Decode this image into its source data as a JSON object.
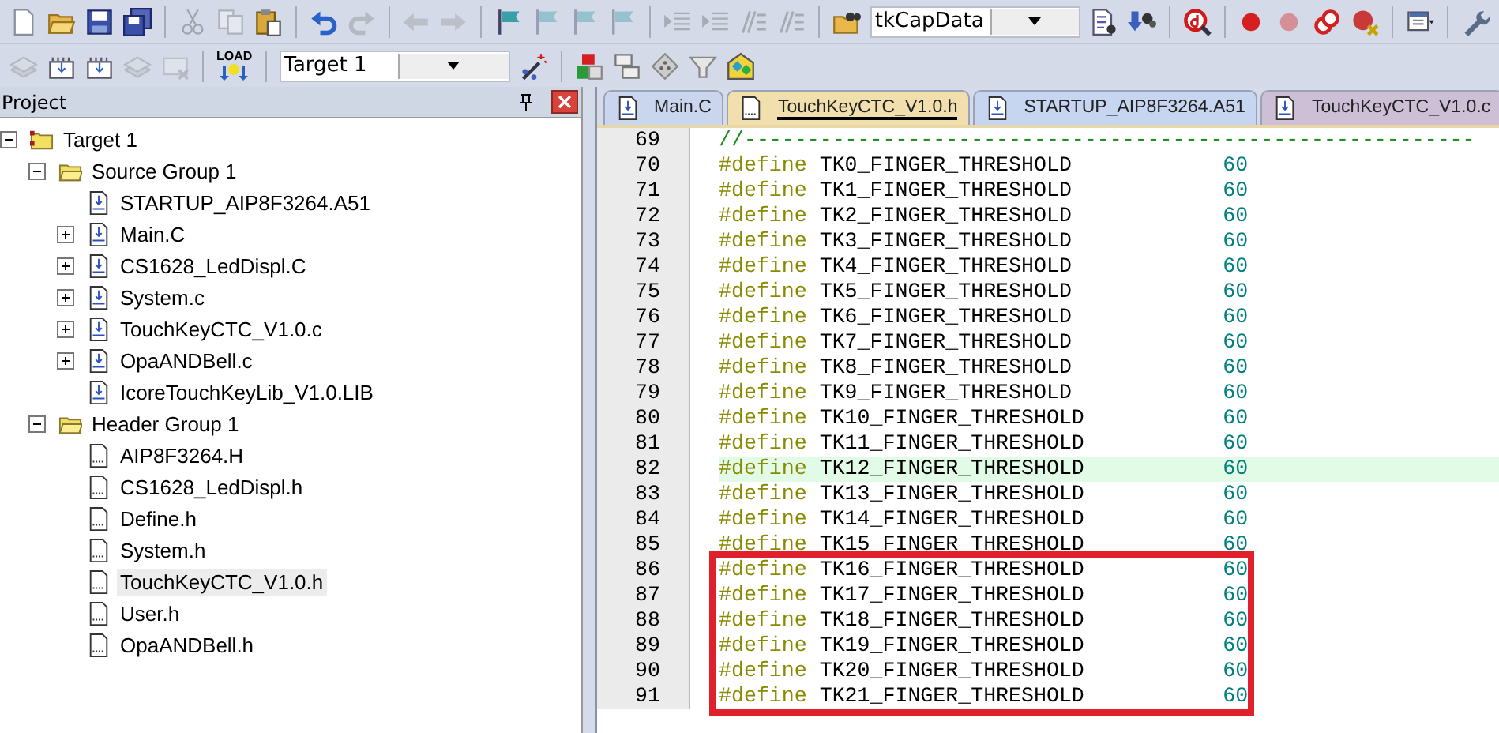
{
  "toolbar_1": [
    {
      "kind": "new",
      "disabled": false
    },
    {
      "kind": "open",
      "disabled": false
    },
    {
      "kind": "save",
      "disabled": false
    },
    {
      "kind": "save-all",
      "disabled": false
    },
    {
      "kind": "sep"
    },
    {
      "kind": "cut",
      "disabled": true
    },
    {
      "kind": "copy",
      "disabled": true
    },
    {
      "kind": "paste",
      "disabled": false
    },
    {
      "kind": "sep"
    },
    {
      "kind": "undo",
      "disabled": false
    },
    {
      "kind": "redo",
      "disabled": true
    },
    {
      "kind": "sep"
    },
    {
      "kind": "back",
      "disabled": true
    },
    {
      "kind": "forward",
      "disabled": true
    },
    {
      "kind": "sep"
    },
    {
      "kind": "flag",
      "disabled": false
    },
    {
      "kind": "flag",
      "disabled": true
    },
    {
      "kind": "flag",
      "disabled": true
    },
    {
      "kind": "flag",
      "disabled": true
    },
    {
      "kind": "sep"
    },
    {
      "kind": "indent",
      "disabled": true
    },
    {
      "kind": "indent",
      "disabled": true
    },
    {
      "kind": "comment",
      "disabled": true
    },
    {
      "kind": "comment",
      "disabled": true
    },
    {
      "kind": "sep"
    },
    {
      "kind": "find-folder",
      "disabled": false
    },
    {
      "kind": "combo",
      "value": "tkCapData"
    },
    {
      "kind": "find-doc",
      "disabled": false
    },
    {
      "kind": "binoculars",
      "disabled": false
    },
    {
      "kind": "sep"
    },
    {
      "kind": "debug",
      "disabled": false
    },
    {
      "kind": "sep"
    },
    {
      "kind": "dot",
      "disabled": false
    },
    {
      "kind": "dot",
      "disabled": true
    },
    {
      "kind": "rings",
      "disabled": false
    },
    {
      "kind": "dot-x",
      "disabled": false
    },
    {
      "kind": "sep"
    },
    {
      "kind": "window-menu",
      "disabled": false
    },
    {
      "kind": "sep"
    },
    {
      "kind": "wrench",
      "disabled": false
    }
  ],
  "toolbar_2": [
    {
      "kind": "stack",
      "disabled": true
    },
    {
      "kind": "chip",
      "disabled": false
    },
    {
      "kind": "chip",
      "disabled": false
    },
    {
      "kind": "stack",
      "disabled": true
    },
    {
      "kind": "chip-x",
      "disabled": true
    },
    {
      "kind": "sep"
    },
    {
      "kind": "load",
      "label": "LOAD",
      "disabled": false
    },
    {
      "kind": "sep"
    },
    {
      "kind": "combo",
      "value": "Target 1"
    },
    {
      "kind": "wand",
      "disabled": false
    },
    {
      "kind": "sep"
    },
    {
      "kind": "blocks",
      "disabled": false
    },
    {
      "kind": "windows",
      "disabled": false
    },
    {
      "kind": "diamond",
      "disabled": false
    },
    {
      "kind": "funnel",
      "disabled": false
    },
    {
      "kind": "gems",
      "disabled": false
    }
  ],
  "project_panel": {
    "title": "Project",
    "tree": [
      {
        "label": "Target 1",
        "kind": "target",
        "expanded": true,
        "selected": false,
        "children": [
          {
            "label": "Source Group 1",
            "kind": "group",
            "expanded": true,
            "selected": false,
            "children": [
              {
                "label": "STARTUP_AIP8F3264.A51",
                "kind": "source",
                "selected": false
              },
              {
                "label": "Main.C",
                "kind": "source",
                "expanded": false,
                "selected": false
              },
              {
                "label": "CS1628_LedDispl.C",
                "kind": "source",
                "expanded": false,
                "selected": false
              },
              {
                "label": "System.c",
                "kind": "source",
                "expanded": false,
                "selected": false
              },
              {
                "label": "TouchKeyCTC_V1.0.c",
                "kind": "source",
                "expanded": false,
                "selected": false
              },
              {
                "label": "OpaANDBell.c",
                "kind": "source",
                "expanded": false,
                "selected": false
              },
              {
                "label": "IcoreTouchKeyLib_V1.0.LIB",
                "kind": "source",
                "selected": false
              }
            ]
          },
          {
            "label": "Header Group 1",
            "kind": "group",
            "expanded": true,
            "selected": false,
            "children": [
              {
                "label": "AIP8F3264.H",
                "kind": "header",
                "selected": false
              },
              {
                "label": "CS1628_LedDispl.h",
                "kind": "header",
                "selected": false
              },
              {
                "label": "Define.h",
                "kind": "header",
                "selected": false
              },
              {
                "label": "System.h",
                "kind": "header",
                "selected": false
              },
              {
                "label": "TouchKeyCTC_V1.0.h",
                "kind": "header",
                "selected": true
              },
              {
                "label": "User.h",
                "kind": "header",
                "selected": false
              },
              {
                "label": "OpaANDBell.h",
                "kind": "header",
                "selected": false
              }
            ]
          }
        ]
      }
    ]
  },
  "editor": {
    "tabs": [
      {
        "label": "Main.C",
        "kind": "source",
        "selected": false,
        "color": "#c9d6ee"
      },
      {
        "label": "TouchKeyCTC_V1.0.h",
        "kind": "header",
        "selected": true,
        "color": "#f2dfae"
      },
      {
        "label": "STARTUP_AIP8F3264.A51",
        "kind": "source",
        "selected": false,
        "color": "#c6d5f0"
      },
      {
        "label": "TouchKeyCTC_V1.0.c",
        "kind": "source",
        "selected": false,
        "color": "#cdbfd6"
      }
    ],
    "lines": [
      {
        "number": "69",
        "kind": "comment",
        "text": "//----------------------------------------------------------",
        "highlighted": false,
        "boxed": false
      },
      {
        "number": "70",
        "kind": "define",
        "keyword": "#define",
        "name": "TK0_FINGER_THRESHOLD",
        "value": "60",
        "highlighted": false,
        "boxed": false
      },
      {
        "number": "71",
        "kind": "define",
        "keyword": "#define",
        "name": "TK1_FINGER_THRESHOLD",
        "value": "60",
        "highlighted": false,
        "boxed": false
      },
      {
        "number": "72",
        "kind": "define",
        "keyword": "#define",
        "name": "TK2_FINGER_THRESHOLD",
        "value": "60",
        "highlighted": false,
        "boxed": false
      },
      {
        "number": "73",
        "kind": "define",
        "keyword": "#define",
        "name": "TK3_FINGER_THRESHOLD",
        "value": "60",
        "highlighted": false,
        "boxed": false
      },
      {
        "number": "74",
        "kind": "define",
        "keyword": "#define",
        "name": "TK4_FINGER_THRESHOLD",
        "value": "60",
        "highlighted": false,
        "boxed": false
      },
      {
        "number": "75",
        "kind": "define",
        "keyword": "#define",
        "name": "TK5_FINGER_THRESHOLD",
        "value": "60",
        "highlighted": false,
        "boxed": false
      },
      {
        "number": "76",
        "kind": "define",
        "keyword": "#define",
        "name": "TK6_FINGER_THRESHOLD",
        "value": "60",
        "highlighted": false,
        "boxed": false
      },
      {
        "number": "77",
        "kind": "define",
        "keyword": "#define",
        "name": "TK7_FINGER_THRESHOLD",
        "value": "60",
        "highlighted": false,
        "boxed": false
      },
      {
        "number": "78",
        "kind": "define",
        "keyword": "#define",
        "name": "TK8_FINGER_THRESHOLD",
        "value": "60",
        "highlighted": false,
        "boxed": false
      },
      {
        "number": "79",
        "kind": "define",
        "keyword": "#define",
        "name": "TK9_FINGER_THRESHOLD",
        "value": "60",
        "highlighted": false,
        "boxed": false
      },
      {
        "number": "80",
        "kind": "define",
        "keyword": "#define",
        "name": "TK10_FINGER_THRESHOLD",
        "value": "60",
        "highlighted": false,
        "boxed": false
      },
      {
        "number": "81",
        "kind": "define",
        "keyword": "#define",
        "name": "TK11_FINGER_THRESHOLD",
        "value": "60",
        "highlighted": false,
        "boxed": false
      },
      {
        "number": "82",
        "kind": "define",
        "keyword": "#define",
        "name": "TK12_FINGER_THRESHOLD",
        "value": "60",
        "highlighted": true,
        "boxed": false
      },
      {
        "number": "83",
        "kind": "define",
        "keyword": "#define",
        "name": "TK13_FINGER_THRESHOLD",
        "value": "60",
        "highlighted": false,
        "boxed": false
      },
      {
        "number": "84",
        "kind": "define",
        "keyword": "#define",
        "name": "TK14_FINGER_THRESHOLD",
        "value": "60",
        "highlighted": false,
        "boxed": false
      },
      {
        "number": "85",
        "kind": "define",
        "keyword": "#define",
        "name": "TK15_FINGER_THRESHOLD",
        "value": "60",
        "highlighted": false,
        "boxed": false
      },
      {
        "number": "86",
        "kind": "define",
        "keyword": "#define",
        "name": "TK16_FINGER_THRESHOLD",
        "value": "60",
        "highlighted": false,
        "boxed": true
      },
      {
        "number": "87",
        "kind": "define",
        "keyword": "#define",
        "name": "TK17_FINGER_THRESHOLD",
        "value": "60",
        "highlighted": false,
        "boxed": true
      },
      {
        "number": "88",
        "kind": "define",
        "keyword": "#define",
        "name": "TK18_FINGER_THRESHOLD",
        "value": "60",
        "highlighted": false,
        "boxed": true
      },
      {
        "number": "89",
        "kind": "define",
        "keyword": "#define",
        "name": "TK19_FINGER_THRESHOLD",
        "value": "60",
        "highlighted": false,
        "boxed": true
      },
      {
        "number": "90",
        "kind": "define",
        "keyword": "#define",
        "name": "TK20_FINGER_THRESHOLD",
        "value": "60",
        "highlighted": false,
        "boxed": true
      },
      {
        "number": "91",
        "kind": "define",
        "keyword": "#define",
        "name": "TK21_FINGER_THRESHOLD",
        "value": "60",
        "highlighted": false,
        "boxed": true
      }
    ]
  }
}
